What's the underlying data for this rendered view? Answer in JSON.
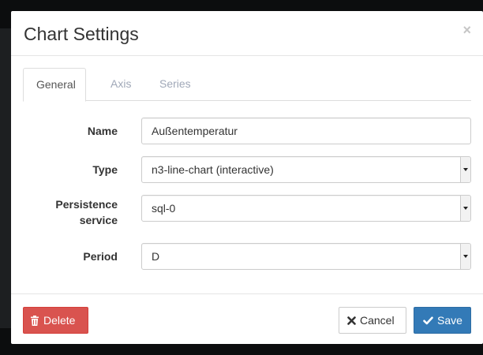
{
  "dialog": {
    "title": "Chart Settings",
    "close_glyph": "×"
  },
  "tabs": [
    {
      "label": "General",
      "active": true
    },
    {
      "label": "Axis",
      "active": false
    },
    {
      "label": "Series",
      "active": false
    }
  ],
  "form": {
    "name": {
      "label": "Name",
      "value": "Außentemperatur"
    },
    "type": {
      "label": "Type",
      "value": "n3-line-chart (interactive)"
    },
    "persistence": {
      "label_line1": "Persistence",
      "label_line2": "service",
      "value": "sql-0"
    },
    "period": {
      "label": "Period",
      "value": "D"
    }
  },
  "footer": {
    "delete_label": "Delete",
    "cancel_label": "Cancel",
    "save_label": "Save"
  },
  "icons": {
    "delete": "trash-icon",
    "cancel": "times-icon",
    "save": "check-icon"
  },
  "colors": {
    "danger": "#d9534f",
    "primary": "#337ab7",
    "inactive_tab": "#a0a8b8"
  }
}
